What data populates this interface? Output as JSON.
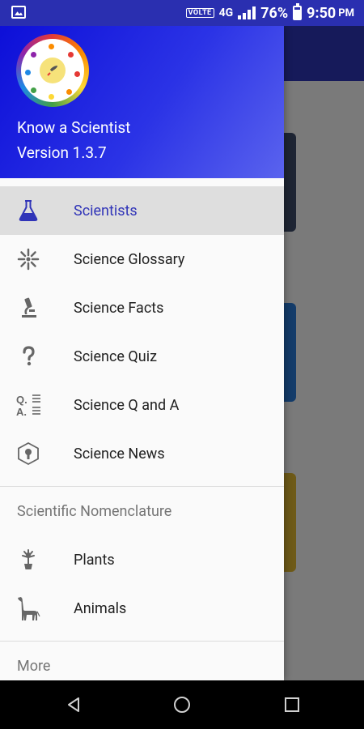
{
  "status_bar": {
    "volte": "VOLTE",
    "network": "4G",
    "battery": "76%",
    "time": "9:50",
    "meridiem": "PM"
  },
  "drawer": {
    "app_name": "Know a Scientist",
    "version": "Version 1.3.7",
    "items": [
      {
        "label": "Scientists",
        "icon": "flask-icon",
        "active": true
      },
      {
        "label": "Science Glossary",
        "icon": "burst-icon",
        "active": false
      },
      {
        "label": "Science Facts",
        "icon": "microscope-icon",
        "active": false
      },
      {
        "label": "Science Quiz",
        "icon": "question-icon",
        "active": false
      },
      {
        "label": "Science Q and A",
        "icon": "qa-icon",
        "active": false
      },
      {
        "label": "Science News",
        "icon": "news-hexagon-icon",
        "active": false
      }
    ],
    "nomenclature_header": "Scientific Nomenclature",
    "nomenclature_items": [
      {
        "label": "Plants",
        "icon": "plant-icon"
      },
      {
        "label": "Animals",
        "icon": "giraffe-icon"
      }
    ],
    "more_header": "More",
    "qa_icon_text_top": "Q.",
    "qa_icon_text_bottom": "A."
  },
  "colors": {
    "header_start": "#0d0fd8",
    "header_end": "#5a63ee",
    "active_label": "#3034b8",
    "active_bg": "#dedede"
  }
}
